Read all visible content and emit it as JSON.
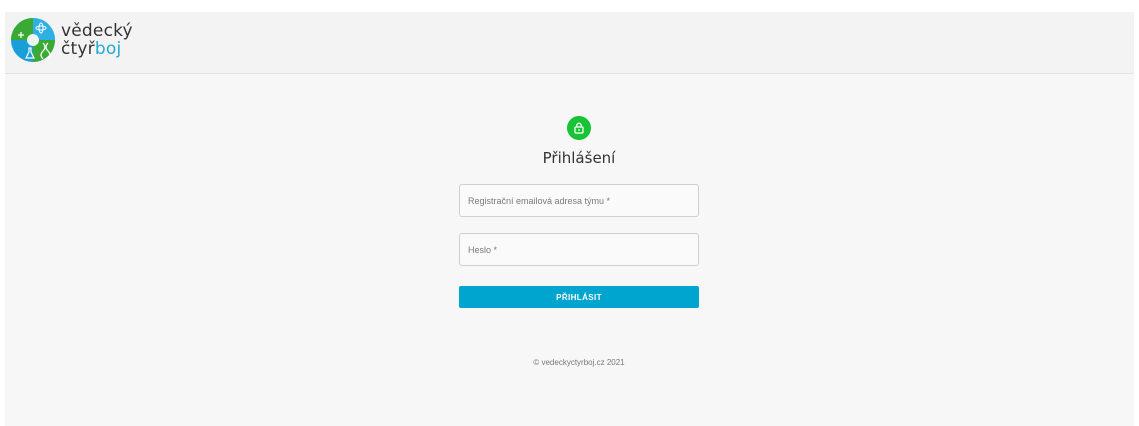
{
  "header": {
    "logo_line1": "vědecký",
    "logo_line2_a": "čtyř",
    "logo_line2_b": "boj"
  },
  "login": {
    "title": "Přihlášení",
    "email_placeholder": "Registrační emailová adresa týmu *",
    "email_value": "",
    "password_placeholder": "Heslo *",
    "password_value": "",
    "submit_label": "PŘIHLÁSIT"
  },
  "footer": {
    "copyright": "© vedeckyctyrboj.cz 2021"
  },
  "icons": {
    "logo": "science-logo-icon",
    "lock": "lock-icon"
  },
  "colors": {
    "accent": "#00a5cf",
    "lock_green": "#18c336",
    "logo_blue": "#1a9ed8",
    "logo_green": "#3aaa35"
  }
}
